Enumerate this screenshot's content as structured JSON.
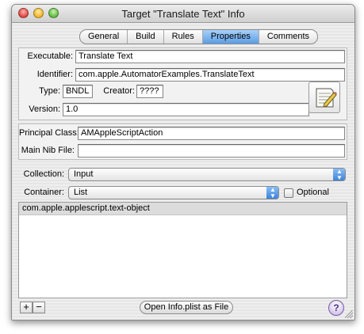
{
  "window": {
    "title": "Target \"Translate Text\" Info"
  },
  "tabs": [
    "General",
    "Build",
    "Rules",
    "Properties",
    "Comments"
  ],
  "active_tab": "Properties",
  "bundle": {
    "executable_label": "Executable:",
    "executable_value": "Translate Text",
    "identifier_label": "Identifier:",
    "identifier_value": "com.apple.AutomatorExamples.TranslateText",
    "type_label": "Type:",
    "type_value": "BNDL",
    "creator_label": "Creator:",
    "creator_value": "????",
    "version_label": "Version:",
    "version_value": "1.0",
    "icon": "document-pencil-icon"
  },
  "principal": {
    "principal_label": "Principal Class:",
    "principal_value": "AMAppleScriptAction",
    "nib_label": "Main Nib File:",
    "nib_value": ""
  },
  "types": {
    "collection_label": "Collection:",
    "collection_value": "Input",
    "container_label": "Container:",
    "container_value": "List",
    "optional_label": "Optional",
    "optional_checked": false,
    "rows": [
      "com.apple.applescript.text-object"
    ]
  },
  "bottom": {
    "add_label": "+",
    "remove_label": "−",
    "open_plist_label": "Open Info.plist as File",
    "help_label": "?"
  }
}
